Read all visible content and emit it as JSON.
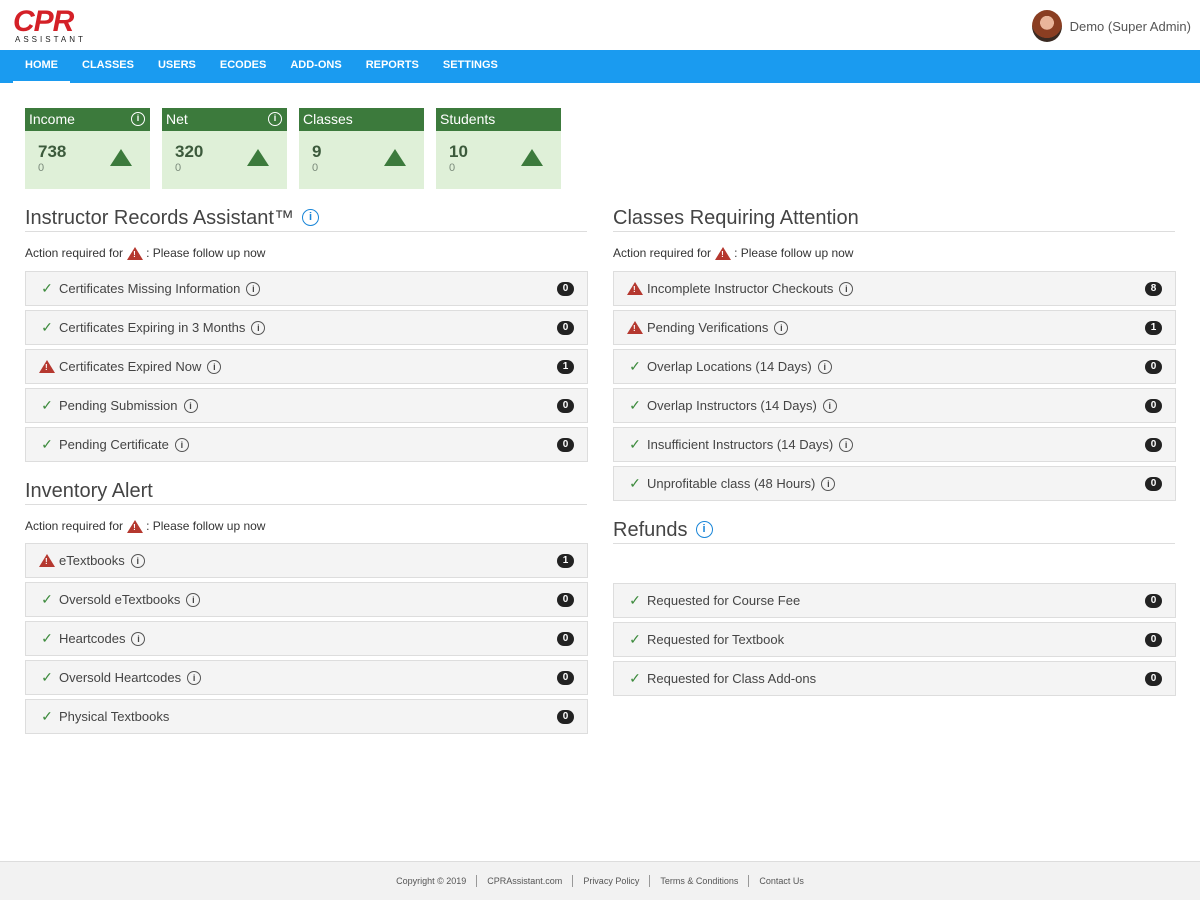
{
  "header": {
    "logo_main": "CPR",
    "logo_sub": "ASSISTANT",
    "user_name": "Demo (Super Admin)"
  },
  "nav": [
    "HOME",
    "CLASSES",
    "USERS",
    "ECODES",
    "ADD-ONS",
    "REPORTS",
    "SETTINGS"
  ],
  "stats": [
    {
      "label": "Income",
      "value": "738",
      "sub": "0"
    },
    {
      "label": "Net",
      "value": "320",
      "sub": "0"
    },
    {
      "label": "Classes",
      "value": "9",
      "sub": "0"
    },
    {
      "label": "Students",
      "value": "10",
      "sub": "0"
    }
  ],
  "instructor_records": {
    "title": "Instructor Records Assistant™",
    "note_prefix": "Action required for",
    "note_suffix": ": Please follow up now",
    "items": [
      {
        "label": "Certificates Missing Information",
        "count": "0",
        "status": "ok"
      },
      {
        "label": "Certificates Expiring in 3 Months",
        "count": "0",
        "status": "ok"
      },
      {
        "label": "Certificates Expired Now",
        "count": "1",
        "status": "warn"
      },
      {
        "label": "Pending Submission",
        "count": "0",
        "status": "ok"
      },
      {
        "label": "Pending Certificate",
        "count": "0",
        "status": "ok"
      }
    ]
  },
  "inventory": {
    "title": "Inventory Alert",
    "note_prefix": "Action required for",
    "note_suffix": ": Please follow up now",
    "items": [
      {
        "label": "eTextbooks",
        "count": "1",
        "status": "warn"
      },
      {
        "label": "Oversold eTextbooks",
        "count": "0",
        "status": "ok"
      },
      {
        "label": "Heartcodes",
        "count": "0",
        "status": "ok"
      },
      {
        "label": "Oversold Heartcodes",
        "count": "0",
        "status": "ok"
      },
      {
        "label": "Physical Textbooks",
        "count": "0",
        "status": "ok"
      }
    ]
  },
  "classes_attention": {
    "title": "Classes Requiring Attention",
    "note_prefix": "Action required for",
    "note_suffix": ": Please follow up now",
    "items": [
      {
        "label": "Incomplete Instructor Checkouts",
        "count": "8",
        "status": "warn"
      },
      {
        "label": "Pending Verifications",
        "count": "1",
        "status": "warn"
      },
      {
        "label": "Overlap Locations (14 Days)",
        "count": "0",
        "status": "ok"
      },
      {
        "label": "Overlap Instructors (14 Days)",
        "count": "0",
        "status": "ok"
      },
      {
        "label": "Insufficient Instructors (14 Days)",
        "count": "0",
        "status": "ok"
      },
      {
        "label": "Unprofitable class (48 Hours)",
        "count": "0",
        "status": "ok"
      }
    ]
  },
  "refunds": {
    "title": "Refunds",
    "items": [
      {
        "label": "Requested for Course Fee",
        "count": "0",
        "status": "ok"
      },
      {
        "label": "Requested for Textbook",
        "count": "0",
        "status": "ok"
      },
      {
        "label": "Requested for Class Add-ons",
        "count": "0",
        "status": "ok"
      }
    ]
  },
  "footer": [
    "Copyright © 2019",
    "CPRAssistant.com",
    "Privacy Policy",
    "Terms & Conditions",
    "Contact Us"
  ],
  "colors": {
    "nav_blue": "#1a9bf0",
    "stat_green": "#3c7a3c",
    "stat_bg": "#dff0d8",
    "warn_red": "#b5382f",
    "logo_red": "#d42027"
  }
}
